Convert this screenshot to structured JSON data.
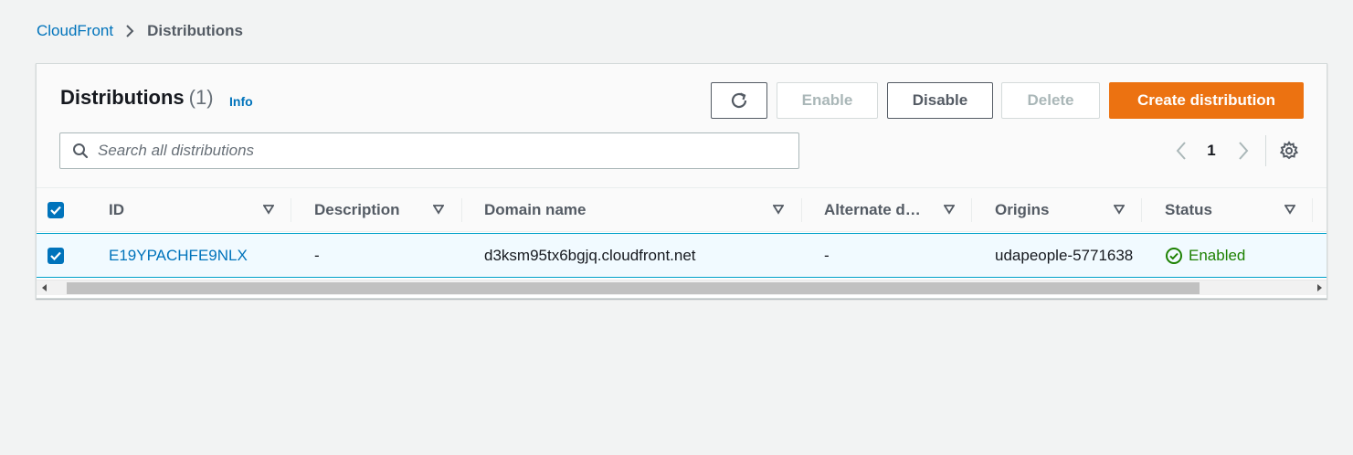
{
  "breadcrumb": {
    "root": "CloudFront",
    "current": "Distributions"
  },
  "panel": {
    "title": "Distributions",
    "count": "(1)",
    "info": "Info"
  },
  "toolbar": {
    "refresh_icon": "refresh-icon",
    "enable": "Enable",
    "disable": "Disable",
    "delete": "Delete",
    "create": "Create distribution",
    "enable_disabled": true,
    "delete_disabled": true
  },
  "search": {
    "placeholder": "Search all distributions",
    "value": ""
  },
  "pagination": {
    "current_page": "1",
    "prev_icon": "chevron-left-icon",
    "next_icon": "chevron-right-icon",
    "settings_icon": "gear-icon"
  },
  "table": {
    "select_all_checked": true,
    "columns": [
      {
        "key": "id",
        "label": "ID"
      },
      {
        "key": "description",
        "label": "Description"
      },
      {
        "key": "domain",
        "label": "Domain name"
      },
      {
        "key": "alternate",
        "label": "Alternate d…"
      },
      {
        "key": "origins",
        "label": "Origins"
      },
      {
        "key": "status",
        "label": "Status"
      }
    ],
    "rows": [
      {
        "selected": true,
        "id": "E19YPACHFE9NLX",
        "description": "-",
        "domain": "d3ksm95tx6bgjq.cloudfront.net",
        "alternate": "-",
        "origins": "udapeople-5771638",
        "status": "Enabled",
        "status_icon": "check-circle-icon"
      }
    ]
  },
  "colors": {
    "accent": "#0073bb",
    "primary_button": "#ec7211",
    "success": "#1d8102",
    "background": "#f2f3f3"
  }
}
